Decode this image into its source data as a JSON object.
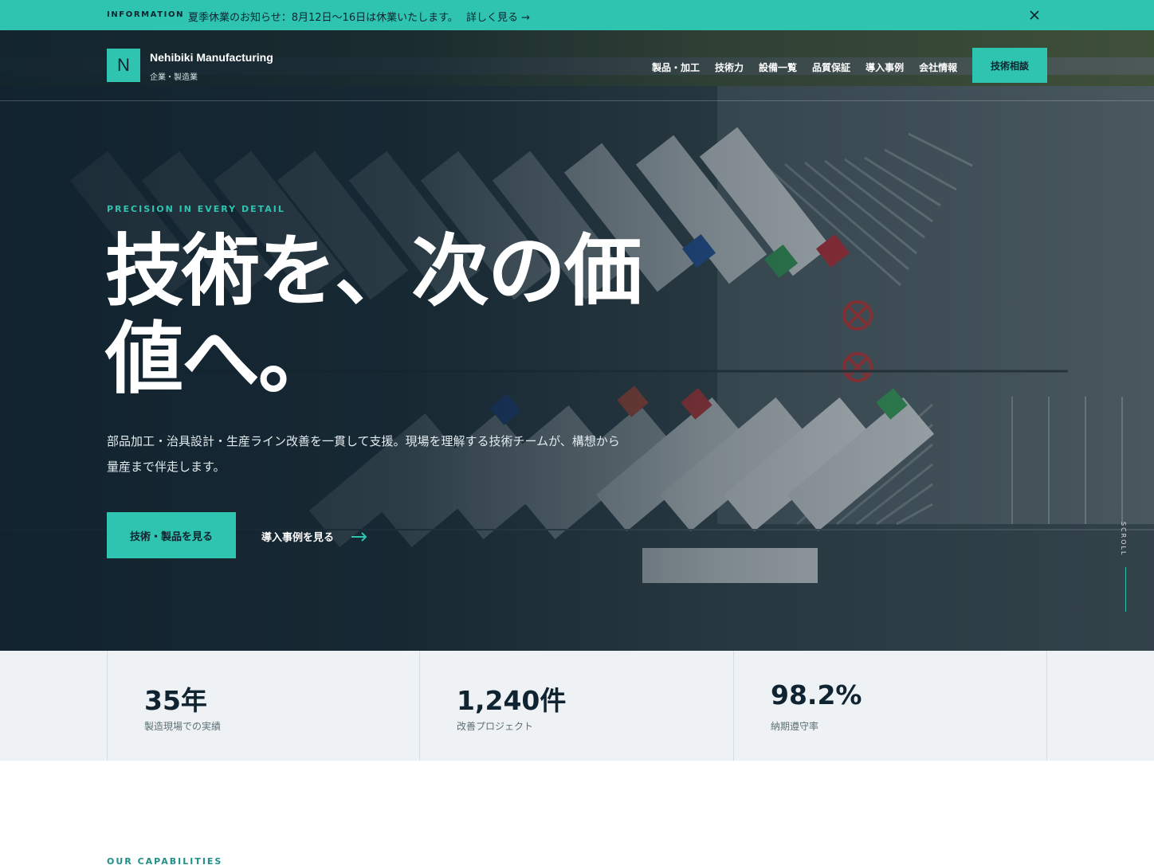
{
  "info_bar": {
    "tag": "INFORMATION",
    "message": "夏季休業のお知らせ：8月12日〜16日は休業いたします。",
    "link": "詳しく見る →",
    "close_icon": "close-icon"
  },
  "header": {
    "logo_letter": "N",
    "brand_name": "Nehibiki Manufacturing",
    "brand_sub": "企業・製造業",
    "nav": [
      "製品・加工",
      "技術力",
      "設備一覧",
      "品質保証",
      "導入事例",
      "会社情報"
    ],
    "cta": "技術相談"
  },
  "hero": {
    "eyebrow": "PRECISION IN EVERY DETAIL",
    "headline": "技術を、次の価値へ。",
    "lead": "部品加工・治具設計・生産ライン改善を一貫して支援。現場を理解する技術チームが、構想から量産まで伴走します。",
    "primary_button": "技術・製品を見る",
    "secondary_link": "導入事例を見る",
    "scroll_label": "SCROLL",
    "background_image": "aerial-truck-parking-lot"
  },
  "stats": [
    {
      "value": "35年",
      "label": "製造現場での実績"
    },
    {
      "value": "1,240件",
      "label": "改善プロジェクト"
    },
    {
      "value": "98.2%",
      "label": "納期遵守率"
    }
  ],
  "capabilities": {
    "eyebrow": "OUR CAPABILITIES"
  },
  "colors": {
    "accent": "#2ec4b0",
    "dark": "#0f2430",
    "stats_bg": "#eef2f4"
  }
}
